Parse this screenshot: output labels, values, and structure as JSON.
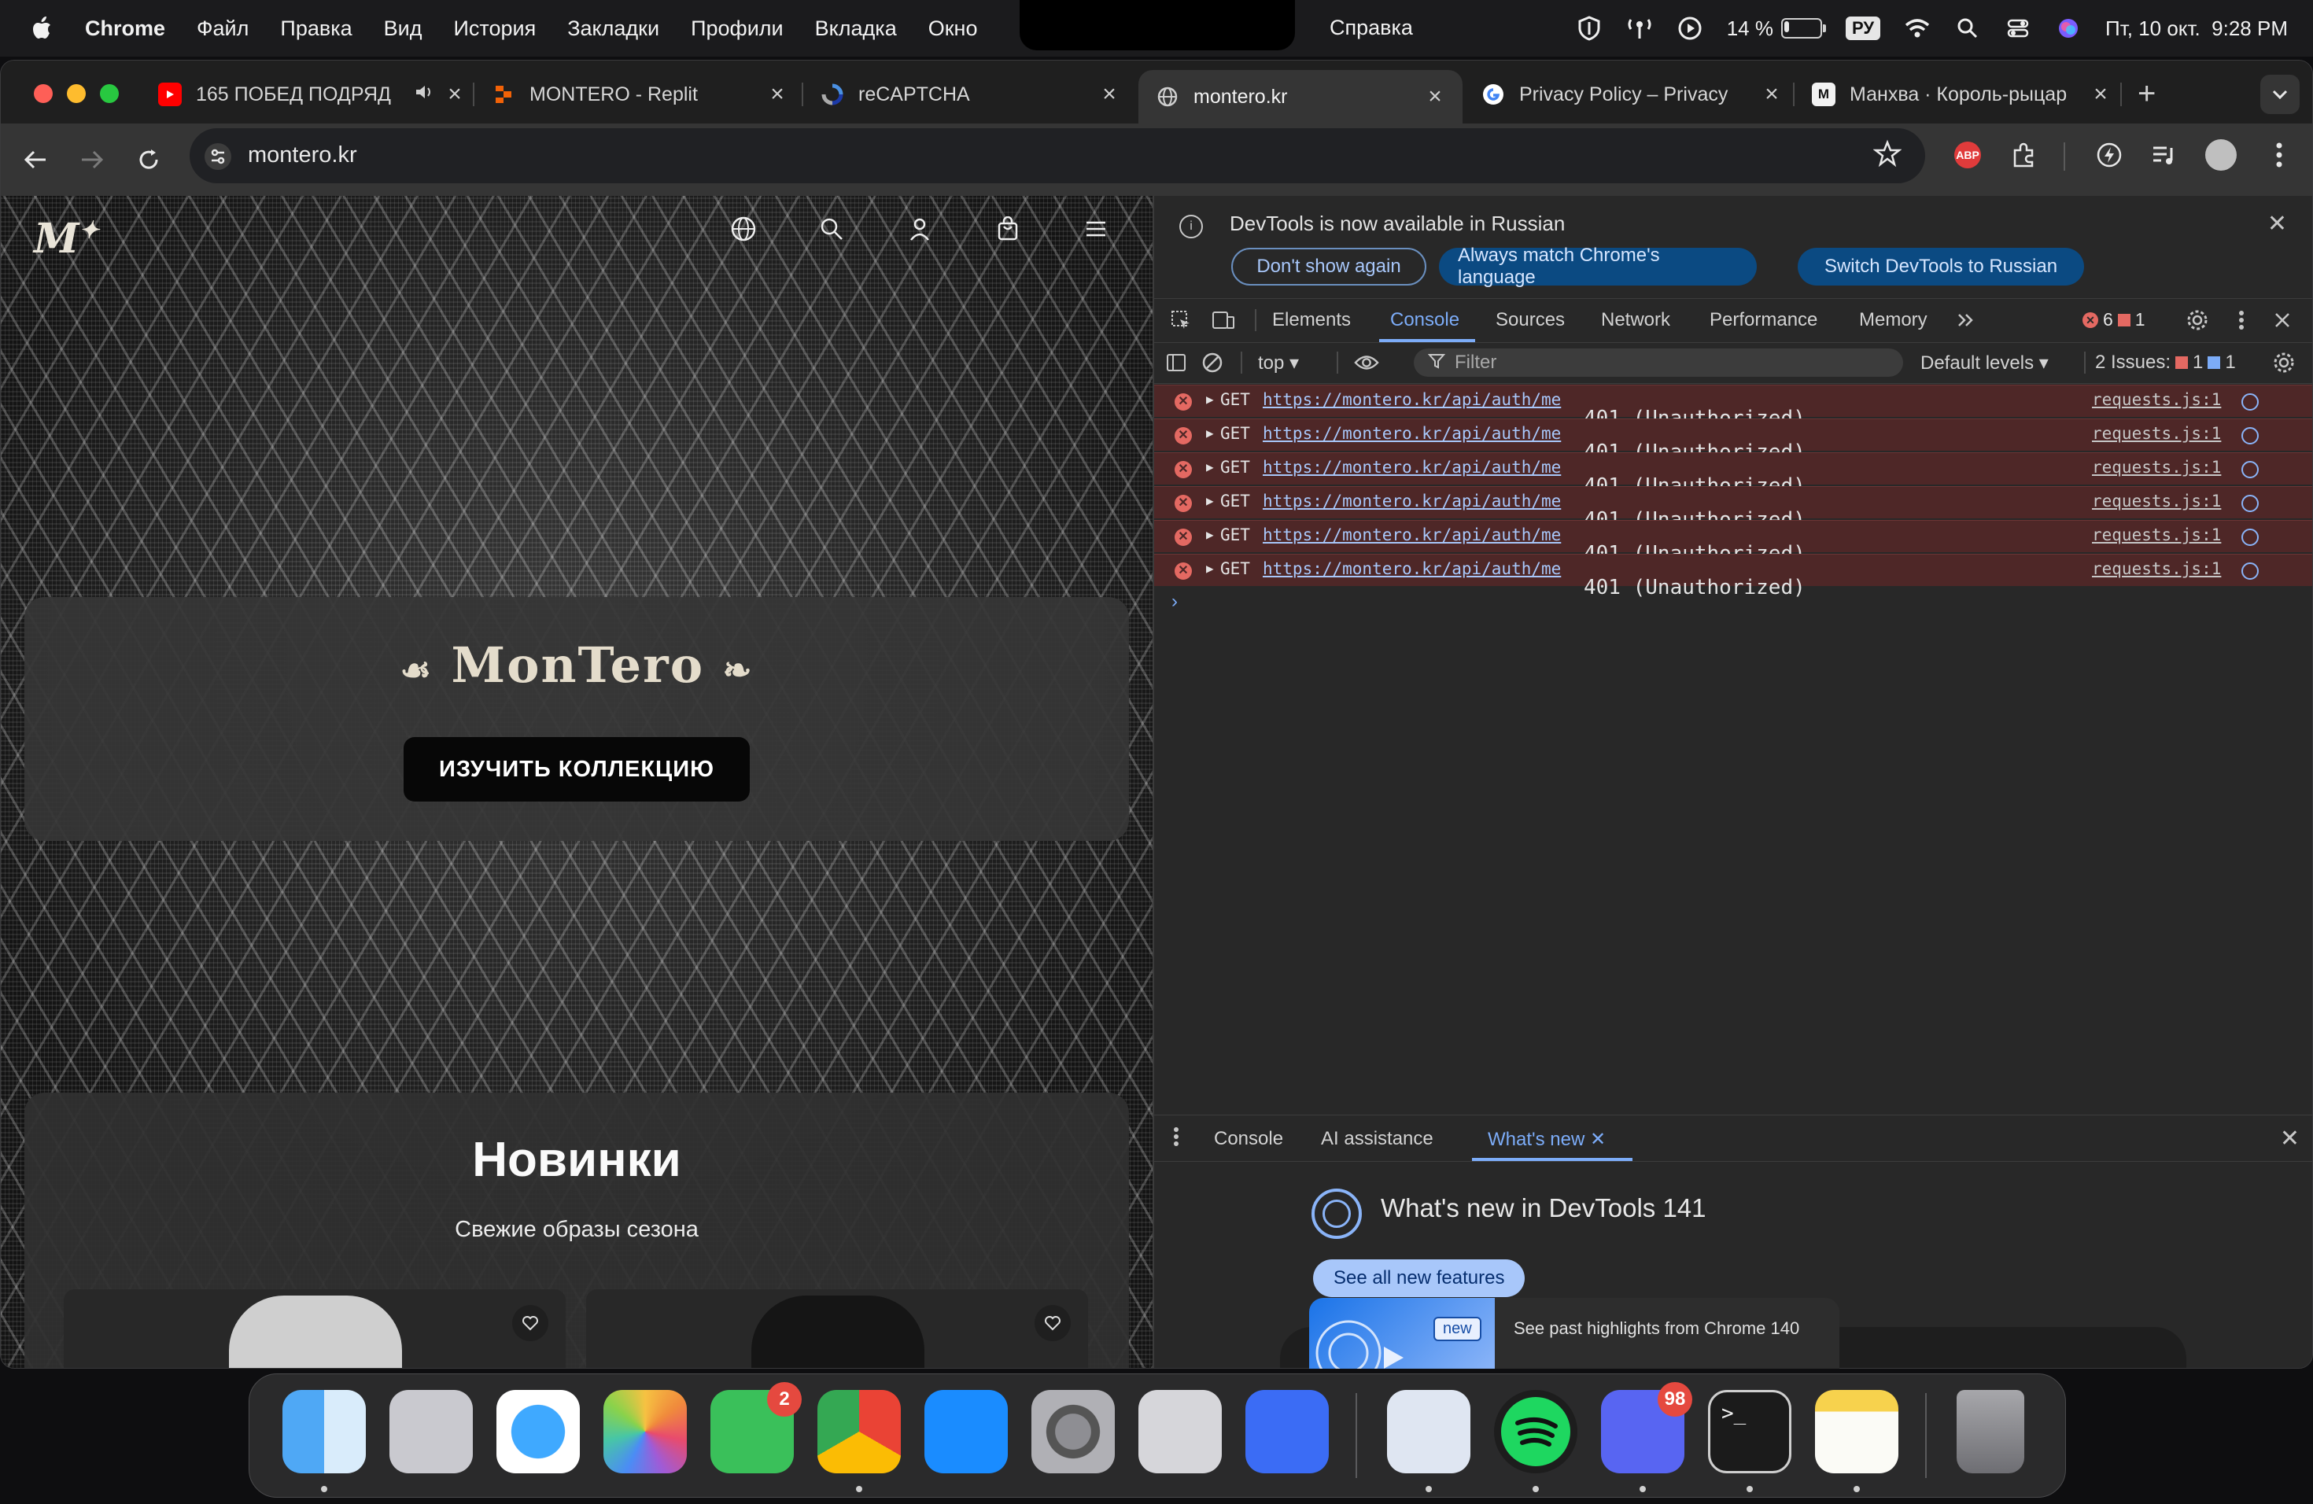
{
  "menubar": {
    "app_name": "Chrome",
    "items": [
      "Файл",
      "Правка",
      "Вид",
      "История",
      "Закладки",
      "Профили",
      "Вкладка",
      "Окно"
    ],
    "help": "Справка",
    "battery_percent": "14 %",
    "battery_level": 0.14,
    "input_source": "РУ",
    "datetime": "Пт, 10 окт.  9:28 PM"
  },
  "tabs": [
    {
      "title": "165 ПОБЕД ПОДРЯД",
      "favicon": "youtube-icon",
      "active": false
    },
    {
      "title": "MONTERO - Replit",
      "favicon": "replit-icon",
      "active": false
    },
    {
      "title": "reCAPTCHA",
      "favicon": "recaptcha-icon",
      "active": false
    },
    {
      "title": "montero.kr",
      "favicon": "globe-icon",
      "active": true
    },
    {
      "title": "Privacy Policy – Privacy",
      "favicon": "google-icon",
      "active": false
    },
    {
      "title": "Манхва · Король-рыцар",
      "favicon": "manga-icon",
      "active": false
    }
  ],
  "omnibox": {
    "url": "montero.kr"
  },
  "page": {
    "logo": "M",
    "logo_mark": "✦",
    "brand": "MonTero",
    "brand_ornament_left": "☙",
    "brand_ornament_right": "❧",
    "cta": "ИЗУЧИТЬ КОЛЛЕКЦИЮ",
    "new_title": "Новинки",
    "new_subtitle": "Свежие образы сезона"
  },
  "devtools": {
    "banner_message": "DevTools is now available in Russian",
    "btn_dont_show": "Don't show again",
    "btn_match": "Always match Chrome's language",
    "btn_switch": "Switch DevTools to Russian",
    "tabs": [
      "Elements",
      "Console",
      "Sources",
      "Network",
      "Performance",
      "Memory"
    ],
    "active_tab": "Console",
    "error_count": "6",
    "warning_count": "1",
    "context": "top",
    "filter_placeholder": "Filter",
    "levels": "Default levels",
    "issues_label": "2 Issues:",
    "issues_errors": "1",
    "issues_info": "1",
    "console_rows": [
      {
        "method": "GET",
        "url": "https://montero.kr/api/auth/me",
        "status": "401 (Unauthorized)",
        "source": "requests.js:1"
      },
      {
        "method": "GET",
        "url": "https://montero.kr/api/auth/me",
        "status": "401 (Unauthorized)",
        "source": "requests.js:1"
      },
      {
        "method": "GET",
        "url": "https://montero.kr/api/auth/me",
        "status": "401 (Unauthorized)",
        "source": "requests.js:1"
      },
      {
        "method": "GET",
        "url": "https://montero.kr/api/auth/me",
        "status": "401 (Unauthorized)",
        "source": "requests.js:1"
      },
      {
        "method": "GET",
        "url": "https://montero.kr/api/auth/me",
        "status": "401 (Unauthorized)",
        "source": "requests.js:1"
      },
      {
        "method": "GET",
        "url": "https://montero.kr/api/auth/me",
        "status": "401 (Unauthorized)",
        "source": "requests.js:1"
      }
    ],
    "drawer_tabs": [
      "Console",
      "AI assistance",
      "What's new"
    ],
    "drawer_active": "What's new",
    "whats_new_title": "What's new in DevTools 141",
    "see_features": "See all new features",
    "new_badge": "new",
    "past_highlights": "See past highlights from Chrome 140"
  },
  "dock": {
    "apps": [
      "finder-icon",
      "launchpad-icon",
      "safari-icon",
      "photos-icon",
      "facetime-icon",
      "chrome-icon",
      "app-store-icon",
      "system-settings-icon",
      "iphone-mirroring-icon",
      "roblox-icon",
      "preview-icon",
      "spotify-icon",
      "discord-icon",
      "terminal-icon",
      "notes-icon",
      "trash-icon"
    ],
    "facetime_badge": "2",
    "discord_badge": "98"
  },
  "colors": {
    "accent_blue": "#7cacf8",
    "error_red": "#e46962",
    "error_row_bg": "#4e2727"
  }
}
